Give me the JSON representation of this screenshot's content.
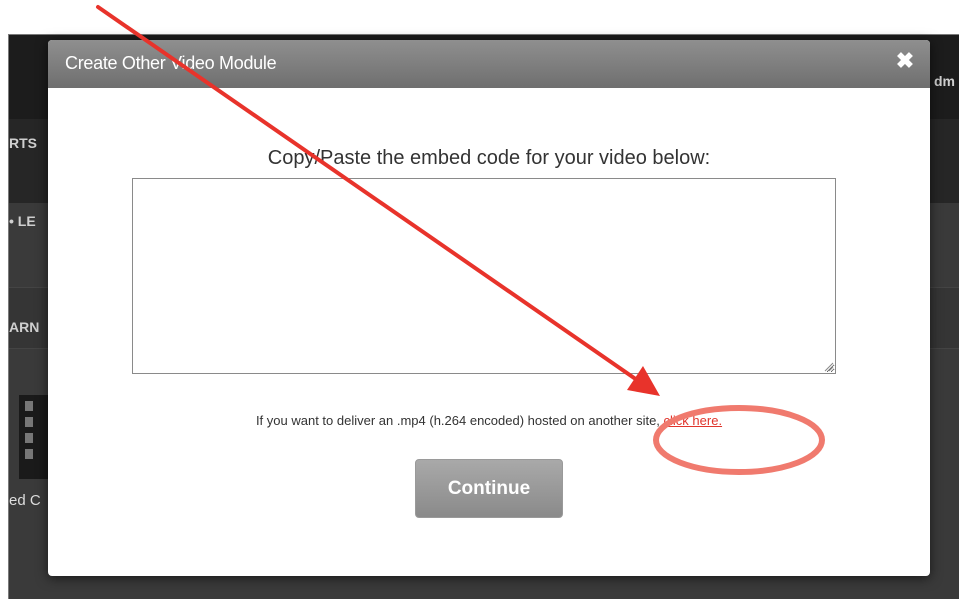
{
  "modal": {
    "title": "Create Other Video Module",
    "close_glyph": "✖",
    "prompt": "Copy/Paste the embed code for your video below:",
    "embed_code_value": "",
    "hint_text": "If you want to deliver an .mp4 (h.264 encoded) hosted on another site, ",
    "hint_link": "click here.",
    "continue_label": "Continue"
  },
  "background": {
    "top_right_text": "dm",
    "left_texts": [
      "RTS",
      "• LE",
      "ARN",
      "ed C"
    ]
  },
  "colors": {
    "accent_red": "#e0352c",
    "modal_header": "#7f7f7f",
    "button": "#9a9a9a"
  }
}
